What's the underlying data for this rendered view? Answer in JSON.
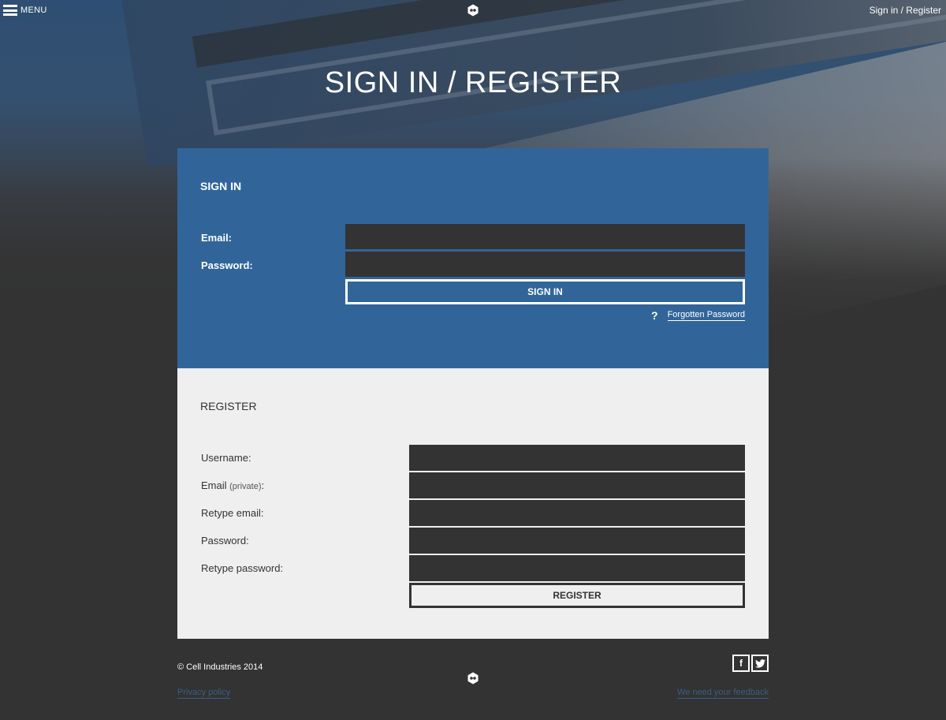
{
  "topbar": {
    "menu_label": "MENU",
    "signin_link": "Sign in / Register"
  },
  "page_title": "SIGN IN / REGISTER",
  "signin": {
    "heading": "SIGN IN",
    "email_label": "Email:",
    "password_label": "Password:",
    "email_value": "",
    "password_value": "",
    "button_label": "SIGN IN",
    "forgot_icon": "?",
    "forgot_label": "Forgotten Password"
  },
  "register": {
    "heading": "REGISTER",
    "username_label": "Username:",
    "email_label": "Email",
    "email_private": "(private)",
    "email_colon": ":",
    "retype_email_label": "Retype email:",
    "password_label": "Password:",
    "retype_password_label": "Retype password:",
    "username_value": "",
    "email_value": "",
    "retype_email_value": "",
    "password_value": "",
    "retype_password_value": "",
    "button_label": "REGISTER"
  },
  "footer": {
    "copyright": "© Cell Industries 2014",
    "privacy_label": "Privacy policy",
    "feedback_label": "We need your feedback",
    "facebook_glyph": "f",
    "social_icons": [
      "facebook-icon",
      "twitter-icon"
    ]
  },
  "colors": {
    "signin_panel": "#31659a",
    "register_panel": "#efefef",
    "background": "#333333",
    "input": "#333333",
    "footer_link": "#3a5e85"
  }
}
